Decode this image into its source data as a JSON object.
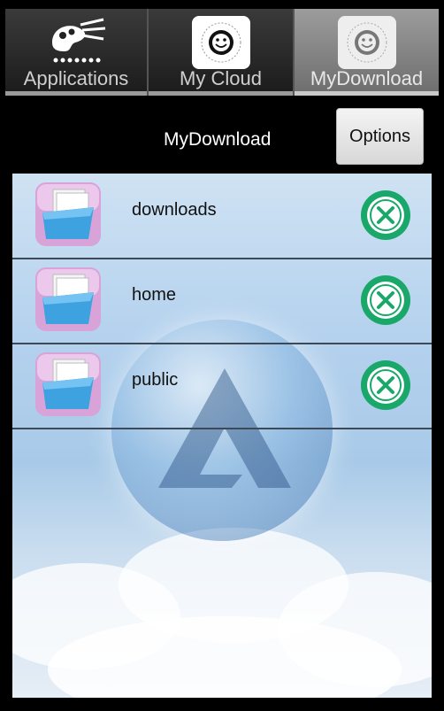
{
  "tabs": [
    {
      "label": "Applications",
      "icon": "palette-icon"
    },
    {
      "label": "My Cloud",
      "icon": "nas-smiley-icon"
    },
    {
      "label": "MyDownload",
      "icon": "nas-smiley-icon"
    }
  ],
  "header": {
    "title": "MyDownload",
    "options_label": "Options"
  },
  "folders": [
    {
      "name": "downloads",
      "icon": "folder-icon",
      "action_icon": "delete-circle-icon"
    },
    {
      "name": "home",
      "icon": "folder-icon",
      "action_icon": "delete-circle-icon"
    },
    {
      "name": "public",
      "icon": "folder-icon",
      "action_icon": "delete-circle-icon"
    }
  ],
  "colors": {
    "delete_green": "#19a86a",
    "panel_sky": "#b5d2ee"
  }
}
